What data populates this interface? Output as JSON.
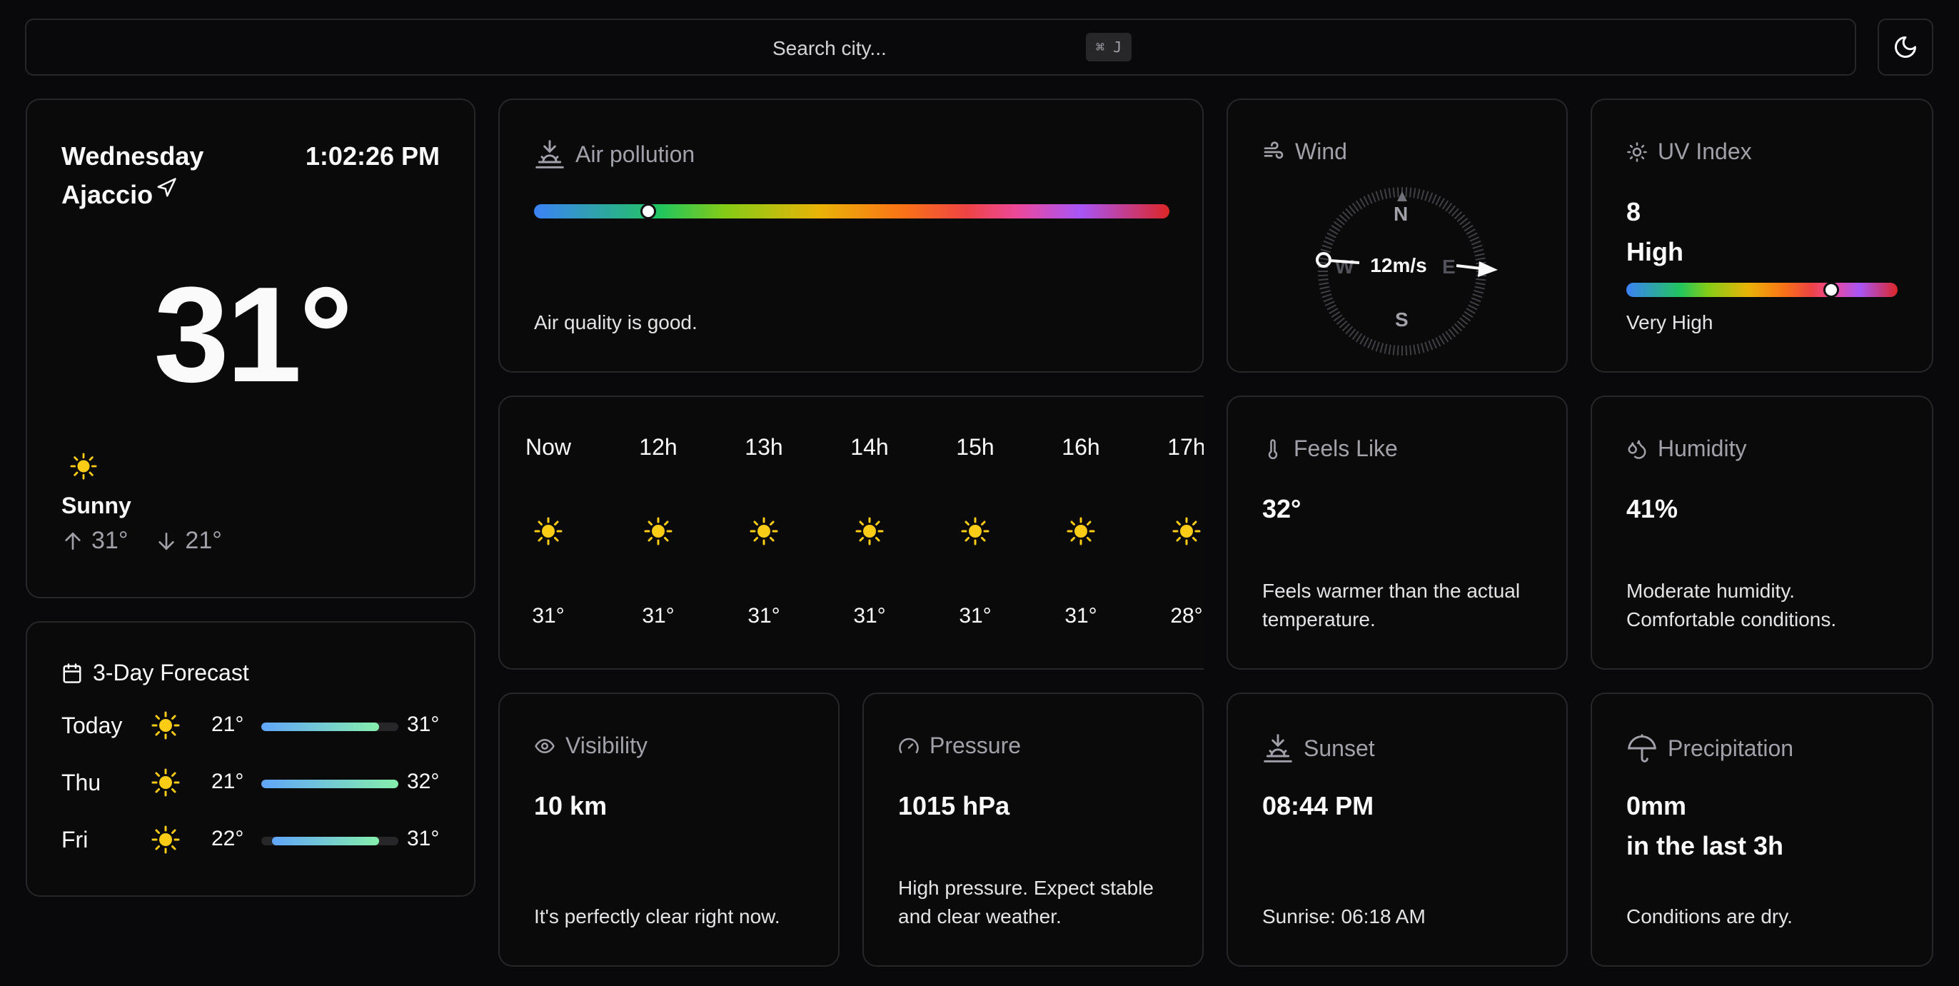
{
  "search": {
    "placeholder": "Search city...",
    "shortcut": "⌘ J"
  },
  "current": {
    "day": "Wednesday",
    "city": "Ajaccio",
    "time": "1:02:26 PM",
    "temp": "31°",
    "condition": "Sunny",
    "high": "31°",
    "low": "21°",
    "icon": "sun-icon"
  },
  "air_pollution": {
    "title": "Air pollution",
    "description": "Air quality is good.",
    "level_fraction": 0.18
  },
  "wind": {
    "title": "Wind",
    "speed": "12m/s",
    "labels": {
      "n": "N",
      "s": "S",
      "e": "E",
      "w": "W"
    }
  },
  "uv": {
    "title": "UV Index",
    "value": "8",
    "category": "High",
    "description": "Very High",
    "level_fraction": 0.755
  },
  "hourly": [
    {
      "label": "Now",
      "temp": "31°"
    },
    {
      "label": "12h",
      "temp": "31°"
    },
    {
      "label": "13h",
      "temp": "31°"
    },
    {
      "label": "14h",
      "temp": "31°"
    },
    {
      "label": "15h",
      "temp": "31°"
    },
    {
      "label": "16h",
      "temp": "31°"
    },
    {
      "label": "17h",
      "temp": "28°"
    }
  ],
  "feels_like": {
    "title": "Feels Like",
    "value": "32°",
    "description": "Feels warmer than the actual temperature."
  },
  "humidity": {
    "title": "Humidity",
    "value": "41%",
    "description": "Moderate humidity. Comfortable conditions."
  },
  "forecast": {
    "title": "3-Day Forecast",
    "days": [
      {
        "day": "Today",
        "min": "21°",
        "max": "31°",
        "bar_start": 0.0,
        "bar_end": 0.86
      },
      {
        "day": "Thu",
        "min": "21°",
        "max": "32°",
        "bar_start": 0.0,
        "bar_end": 1.0
      },
      {
        "day": "Fri",
        "min": "22°",
        "max": "31°",
        "bar_start": 0.08,
        "bar_end": 0.86
      }
    ]
  },
  "visibility": {
    "title": "Visibility",
    "value": "10 km",
    "description": "It's perfectly clear right now."
  },
  "pressure": {
    "title": "Pressure",
    "value": "1015 hPa",
    "description": "High pressure. Expect stable and clear weather."
  },
  "sunset": {
    "title": "Sunset",
    "value": "08:44 PM",
    "description": "Sunrise: 06:18 AM"
  },
  "precipitation": {
    "title": "Precipitation",
    "value_line1": "0mm",
    "value_line2": "in the last 3h",
    "description": "Conditions are dry."
  },
  "colors": {
    "background": "#09090b",
    "border": "#27272a",
    "sun": "#facc15"
  }
}
